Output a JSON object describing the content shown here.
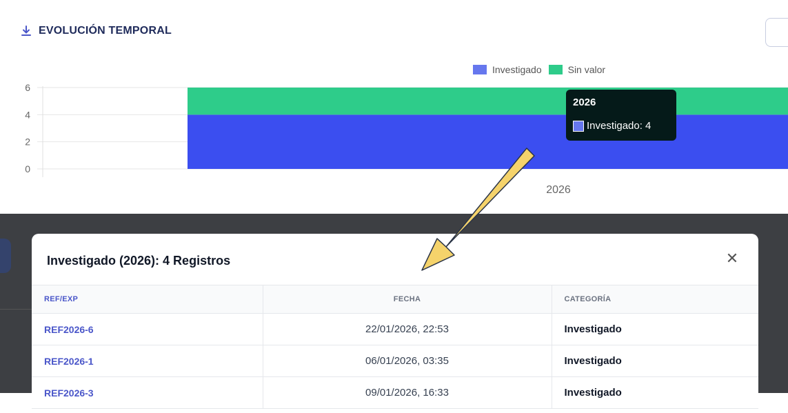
{
  "section": {
    "title": "EVOLUCIÓN TEMPORAL",
    "icon": "download-icon"
  },
  "colors": {
    "investigado": "#3b4ef0",
    "sin_valor": "#2ecc8a",
    "legend_investigado": "#6677ee",
    "accent_arrow": "#f5d36b"
  },
  "chart_data": {
    "type": "bar",
    "stacked": true,
    "categories": [
      "2026"
    ],
    "series": [
      {
        "name": "Investigado",
        "values": [
          4
        ]
      },
      {
        "name": "Sin valor",
        "values": [
          2
        ]
      }
    ],
    "y_ticks": [
      "0",
      "2",
      "4",
      "6"
    ],
    "ylim": [
      0,
      6
    ],
    "legend_position": "top-right",
    "grid": true
  },
  "legend": {
    "investigado": "Investigado",
    "sin_valor": "Sin valor"
  },
  "tooltip": {
    "title": "2026",
    "label": "Investigado: 4"
  },
  "modal": {
    "title": "Investigado (2026): 4 Registros",
    "close_symbol": "✕",
    "columns": [
      "REF/EXP",
      "FECHA",
      "CATEGORÍA"
    ],
    "rows": [
      {
        "ref": "REF2026-6",
        "fecha": "22/01/2026, 22:53",
        "categoria": "Investigado"
      },
      {
        "ref": "REF2026-1",
        "fecha": "06/01/2026, 03:35",
        "categoria": "Investigado"
      },
      {
        "ref": "REF2026-3",
        "fecha": "09/01/2026, 16:33",
        "categoria": "Investigado"
      }
    ]
  }
}
